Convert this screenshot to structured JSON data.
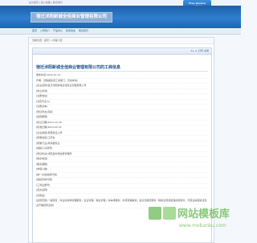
{
  "topbar": {
    "links": "设为首页 | 加入收藏 | 联系我们"
  },
  "badge": {
    "line1": "Free Service",
    "line2": "免费服务"
  },
  "header": {
    "logo_text": "宿迁沭阳新城全佳商业管理有限公司"
  },
  "nav": {
    "items": [
      "首页",
      "公司简介",
      "产品中心",
      "新闻动态",
      "联系我们"
    ]
  },
  "breadcrumb": "当前位置：首页 > 内容介绍",
  "panel": {
    "tools": "A+ A- 打印 关闭"
  },
  "article": {
    "title": "宿迁沭阳新城全佳商业管理有限公司的工商信息",
    "rows": [
      "更新时间:2024-07-12",
      "声明：该数据来源工商部门，仅供参考。",
      "[企业名称]宿迁沭阳新城全佳商业管理有限公司",
      "[成立时间]",
      "[注册地址]",
      "[法定代表人]",
      "[注册资本]",
      "[登记状态]存续",
      "[经营期限]",
      "[成立日期]2021-12-30",
      "[核准日期]2023-05-31",
      "[企业类型]有限责任公司",
      "[所属地区]江苏省",
      "[所属行业]商务服务业",
      "[纳税人识别号]",
      "[登记机关]沭阳县市场监督管理局",
      "[联系电话]",
      "[联系邮箱]",
      "[参保人数]",
      "[统一社会信用代码]",
      "[组织机构代码]",
      "[工商注册号]",
      "[英文名称]",
      "[曾用名]",
      "[经营范围]一般项目：商业综合体管理服务；企业管理；物业管理；停车场服务；市场营销策划；会议及展览服务（除依法须经批准的项目外，凭营业执照依法自主开展经营活动）"
    ]
  },
  "watermark": {
    "main": "网站模板库",
    "sub": "www.mobanku.com"
  },
  "colors": {
    "header": "#2f7fcf",
    "title": "#1a4f8c",
    "watermark_green": "#7cc36b"
  }
}
